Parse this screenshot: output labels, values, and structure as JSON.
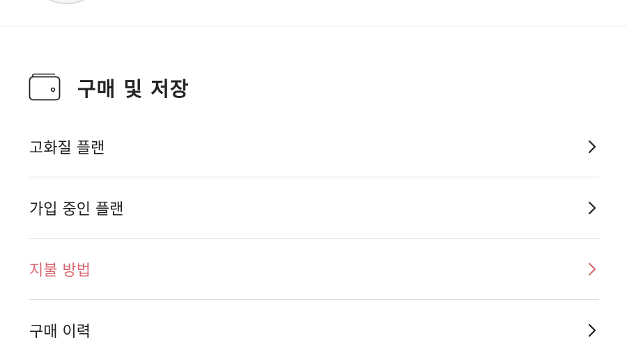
{
  "section": {
    "title": "구매 및 저장",
    "icon": "wallet-icon"
  },
  "menu": {
    "items": [
      {
        "label": "고화질 플랜",
        "icon": "chevron-right-icon",
        "active": false
      },
      {
        "label": "가입 중인 플랜",
        "icon": "chevron-right-icon",
        "active": false
      },
      {
        "label": "지불 방법",
        "icon": "chevron-right-icon",
        "active": true
      },
      {
        "label": "구매 이력",
        "icon": "chevron-right-icon",
        "active": false
      }
    ]
  },
  "colors": {
    "active_text": "#d96a72",
    "text": "#1f1f1f",
    "divider": "#dedede"
  }
}
